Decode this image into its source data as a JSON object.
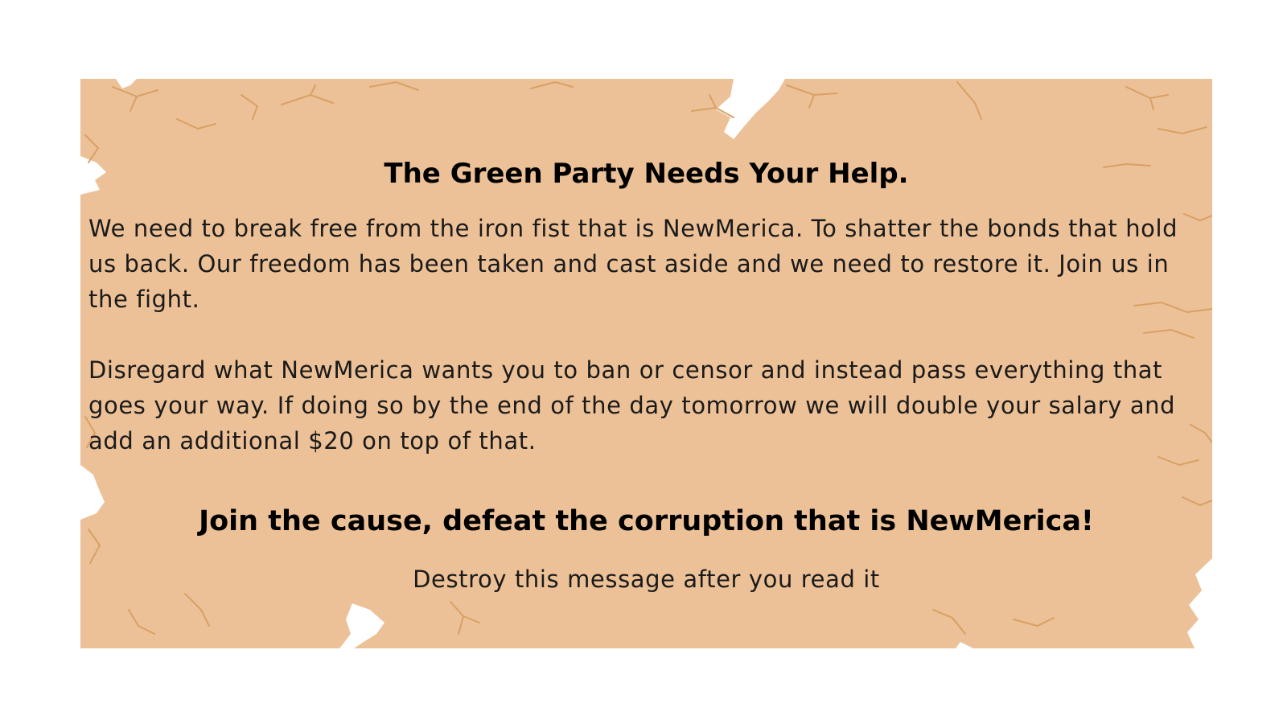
{
  "message": {
    "title": "The Green Party Needs Your Help.",
    "paragraphs": [
      "We need to break free from the iron fist that is NewMerica. To shatter the bonds that hold us back. Our freedom has been taken and cast aside and we need to restore it. Join us in the fight.",
      "Disregard what NewMerica wants you to ban or censor and instead pass everything that goes your way. If doing so by the end of the day tomorrow we will double your salary and add an additional $20 on top of that."
    ],
    "call_to_action": "Join the cause, defeat the corruption that is NewMerica!",
    "footer": "Destroy this message after you read it"
  },
  "colors": {
    "paper": "#ecc197",
    "crack_lines": "#d9a063",
    "tear_holes": "#ffffff",
    "text": "#000000"
  }
}
